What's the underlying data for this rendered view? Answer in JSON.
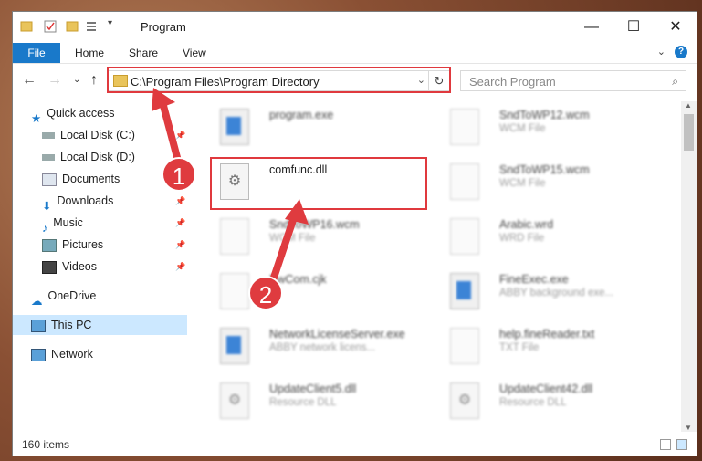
{
  "window": {
    "title": "Program"
  },
  "ribbon": {
    "file": "File",
    "tabs": [
      "Home",
      "Share",
      "View"
    ]
  },
  "address": {
    "path": "C:\\Program Files\\Program Directory"
  },
  "search": {
    "placeholder": "Search Program"
  },
  "sidebar": {
    "items": [
      {
        "label": "Quick access",
        "icon": "star-icon"
      },
      {
        "label": "Local Disk (C:)",
        "icon": "drive-icon"
      },
      {
        "label": "Local Disk (D:)",
        "icon": "drive-icon"
      },
      {
        "label": "Documents",
        "icon": "documents-icon"
      },
      {
        "label": "Downloads",
        "icon": "downloads-icon"
      },
      {
        "label": "Music",
        "icon": "music-icon"
      },
      {
        "label": "Pictures",
        "icon": "pictures-icon"
      },
      {
        "label": "Videos",
        "icon": "videos-icon"
      },
      {
        "label": "OneDrive",
        "icon": "onedrive-icon"
      },
      {
        "label": "This PC",
        "icon": "pc-icon"
      },
      {
        "label": "Network",
        "icon": "network-icon"
      }
    ]
  },
  "files": [
    {
      "name": "program.exe",
      "type": ""
    },
    {
      "name": "SndToWP12.wcm",
      "type": "WCM File"
    },
    {
      "name": "comfunc.dll",
      "type": ""
    },
    {
      "name": "SndToWP15.wcm",
      "type": "WCM File"
    },
    {
      "name": "SndToWP16.wcm",
      "type": "WCM File"
    },
    {
      "name": "Arabic.wrd",
      "type": "WRD File"
    },
    {
      "name": "EwCom.cjk",
      "type": ""
    },
    {
      "name": "FineExec.exe",
      "type": "ABBY background exe..."
    },
    {
      "name": "NetworkLicenseServer.exe",
      "type": "ABBY network licens..."
    },
    {
      "name": "help.fineReader.txt",
      "type": "TXT File"
    },
    {
      "name": "UpdateClient5.dll",
      "type": "Resource DLL"
    },
    {
      "name": "UpdateClient42.dll",
      "type": "Resource DLL"
    }
  ],
  "status": {
    "count": "160 items"
  },
  "callouts": {
    "one": "1",
    "two": "2"
  },
  "colors": {
    "accent": "#1979ca",
    "highlight": "#e0393e",
    "selected": "#cce8ff"
  }
}
